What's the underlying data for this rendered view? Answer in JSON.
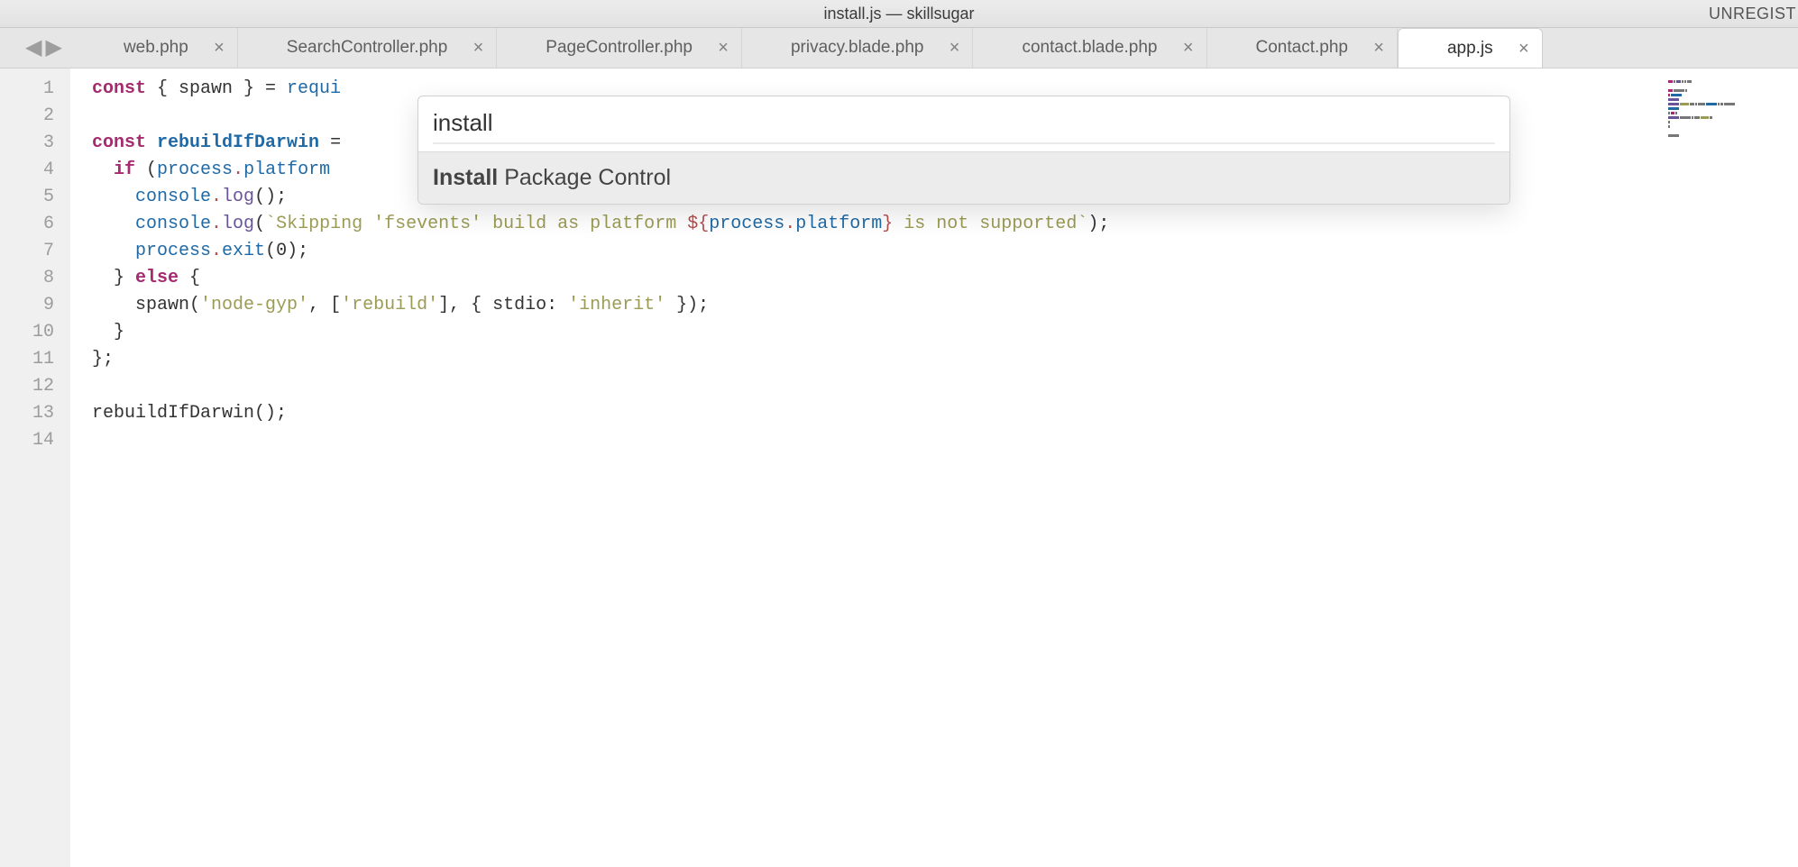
{
  "window": {
    "title": "install.js — skillsugar",
    "registration": "UNREGIST"
  },
  "tabs": [
    {
      "label": "web.php",
      "active": false
    },
    {
      "label": "SearchController.php",
      "active": false
    },
    {
      "label": "PageController.php",
      "active": false
    },
    {
      "label": "privacy.blade.php",
      "active": false
    },
    {
      "label": "contact.blade.php",
      "active": false
    },
    {
      "label": "Contact.php",
      "active": false
    },
    {
      "label": "app.js",
      "active": true
    }
  ],
  "gutter": {
    "start": 1,
    "end": 14
  },
  "code": {
    "lines": [
      "const { spawn } = requi",
      "",
      "const rebuildIfDarwin =",
      "  if (process.platform ",
      "    console.log();",
      "    console.log(`Skipping 'fsevents' build as platform ${process.platform} is not supported`);",
      "    process.exit(0);",
      "  } else {",
      "    spawn('node-gyp', ['rebuild'], { stdio: 'inherit' });",
      "  }",
      "};",
      "",
      "rebuildIfDarwin();",
      ""
    ]
  },
  "palette": {
    "input_value": "install",
    "items": [
      {
        "match": "Install",
        "rest": " Package Control"
      }
    ]
  },
  "glyphs": {
    "close": "×",
    "nav_back": "◀",
    "nav_fwd": "▶"
  }
}
